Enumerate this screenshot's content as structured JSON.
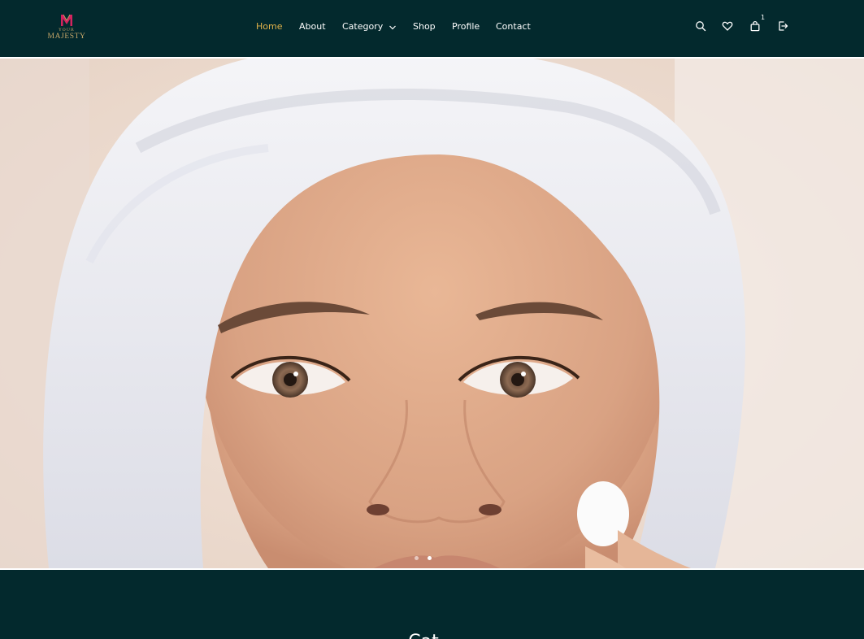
{
  "brand": {
    "logo_small": "YOUR",
    "logo_big": "MAJESTY",
    "logo_mark": "M"
  },
  "nav": {
    "items": [
      {
        "label": "Home",
        "active": true
      },
      {
        "label": "About"
      },
      {
        "label": "Category",
        "dropdown": true
      },
      {
        "label": "Shop"
      },
      {
        "label": "Profile"
      },
      {
        "label": "Contact"
      }
    ]
  },
  "header_icons": {
    "search": "search-icon",
    "wishlist": "heart-icon",
    "cart": "shopping-bag-icon",
    "cart_count": "1",
    "logout": "logout-icon"
  },
  "hero": {
    "slides": 2,
    "active_slide": 2,
    "image": "woman with white towel on head cleansing face with cotton pad"
  },
  "section": {
    "title": "Cat..."
  },
  "colors": {
    "header_bg": "#03292d",
    "accent": "#e2b24a",
    "logo_gold": "#c9a96a",
    "logo_pink": "#d3245f"
  }
}
